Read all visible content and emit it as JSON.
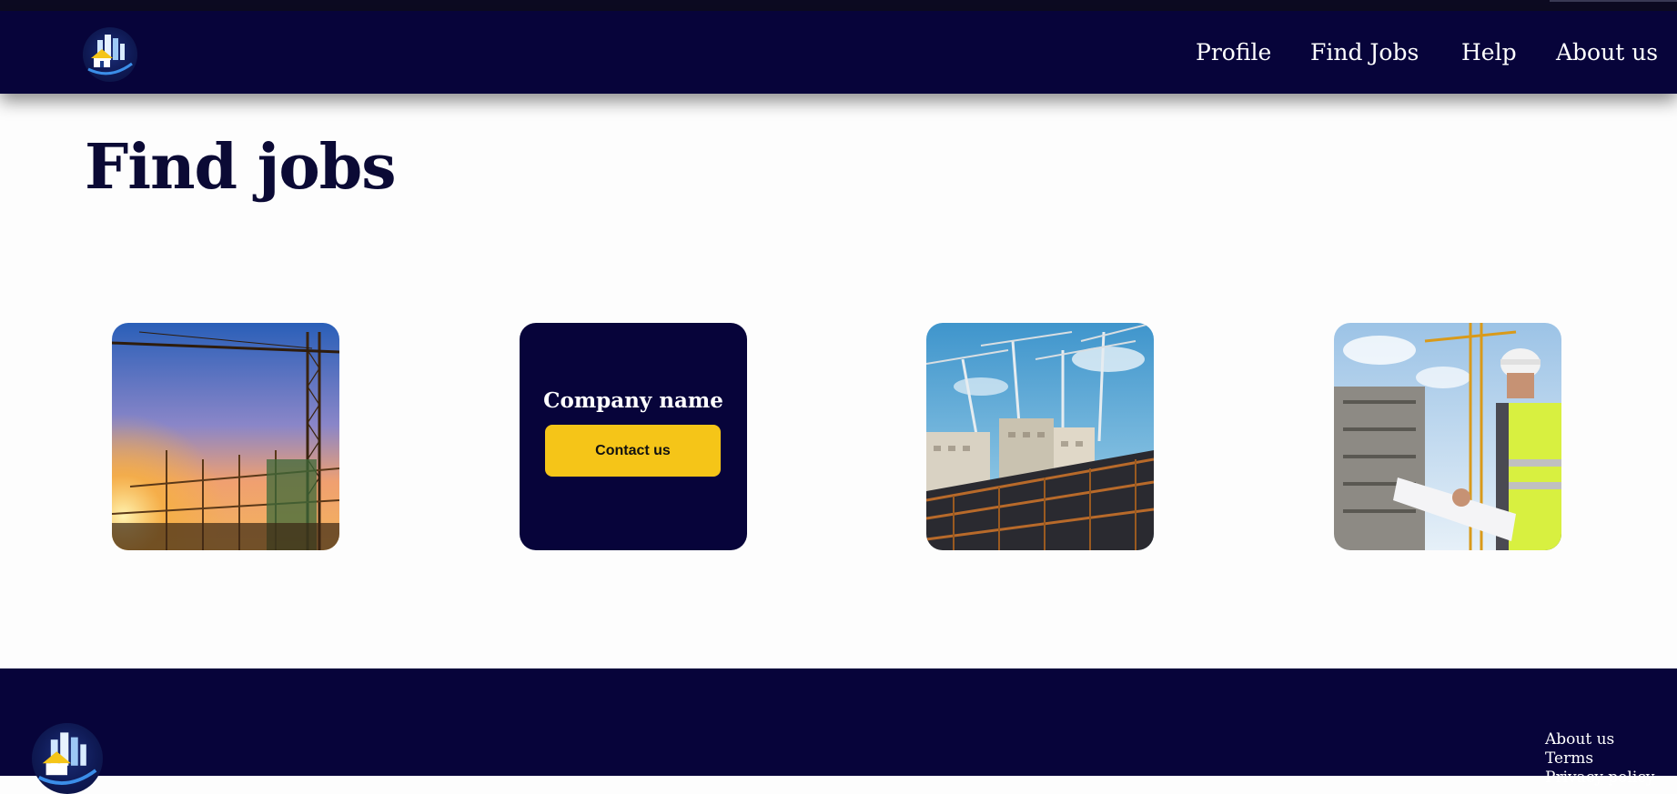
{
  "header": {
    "logo_icon": "construction-city-logo",
    "nav": [
      {
        "label": "Profile"
      },
      {
        "label": "Find Jobs"
      },
      {
        "label": "Help"
      },
      {
        "label": "About us"
      }
    ]
  },
  "main": {
    "title": "Find jobs",
    "cards": [
      {
        "type": "image",
        "image": "construction-site-sunset-crane"
      },
      {
        "type": "company",
        "company_name": "Company name",
        "button_label": "Contact us"
      },
      {
        "type": "image",
        "image": "cranes-over-building-frame"
      },
      {
        "type": "image",
        "image": "engineer-with-blueprints"
      }
    ]
  },
  "footer": {
    "logo_icon": "construction-city-logo",
    "links": [
      "About us",
      "Terms",
      "Privacy policy"
    ]
  },
  "colors": {
    "navy": "#07043a",
    "accent_yellow": "#f5c518",
    "title_text": "#0b0a35"
  }
}
